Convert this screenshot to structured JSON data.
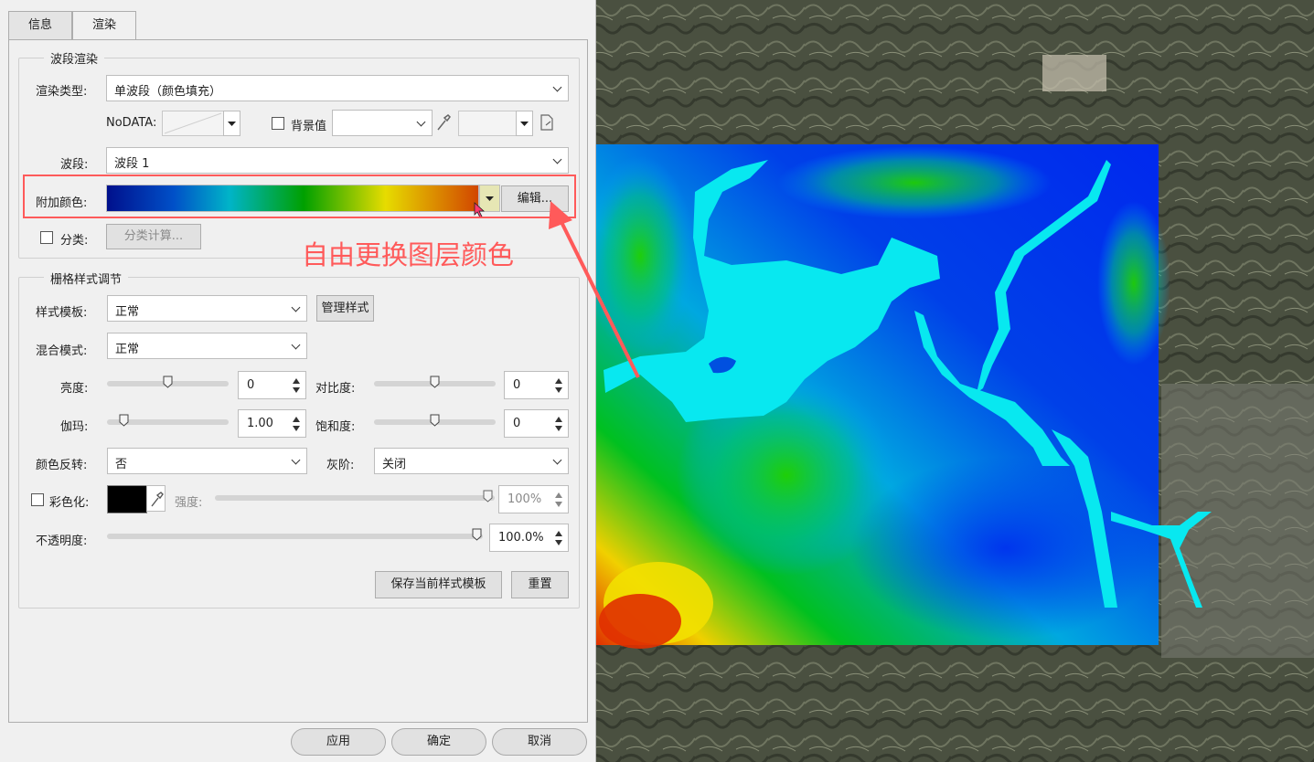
{
  "tabs": [
    "信息",
    "渲染"
  ],
  "band_render": {
    "title": "波段渲染",
    "render_type_label": "渲染类型:",
    "render_type_value": "单波段（颜色填充）",
    "nodata_label": "NoDATA:",
    "background_label": "背景值",
    "band_label": "波段:",
    "band_value": "波段 1",
    "color_label": "附加颜色:",
    "edit_button": "编辑...",
    "classify_label": "分类:",
    "classify_button": "分类计算..."
  },
  "raster_style": {
    "title": "栅格样式调节",
    "template_label": "样式模板:",
    "template_value": "正常",
    "manage_button": "管理样式",
    "blend_label": "混合模式:",
    "blend_value": "正常",
    "brightness_label": "亮度:",
    "brightness_value": "0",
    "contrast_label": "对比度:",
    "contrast_value": "0",
    "gamma_label": "伽玛:",
    "gamma_value": "1.00",
    "saturation_label": "饱和度:",
    "saturation_value": "0",
    "invert_label": "颜色反转:",
    "invert_value": "否",
    "grayscale_label": "灰阶:",
    "grayscale_value": "关闭",
    "colorize_label": "彩色化:",
    "strength_label": "强度:",
    "strength_value": "100%",
    "opacity_label": "不透明度:",
    "opacity_value": "100.0%",
    "save_template_button": "保存当前样式模板",
    "reset_button": "重置"
  },
  "footer": {
    "apply": "应用",
    "ok": "确定",
    "cancel": "取消"
  },
  "annotation": "自由更换图层颜色",
  "colors": {
    "annotation": "#ff5a5a",
    "ramp": [
      "#00108c",
      "#0050c8",
      "#00b4c8",
      "#00a000",
      "#e6dc00",
      "#d24600"
    ]
  },
  "icons": [
    "dropdown-icon",
    "eyedropper-icon",
    "export-icon",
    "slider-thumb-icon",
    "cursor-icon",
    "arrow-icon"
  ]
}
